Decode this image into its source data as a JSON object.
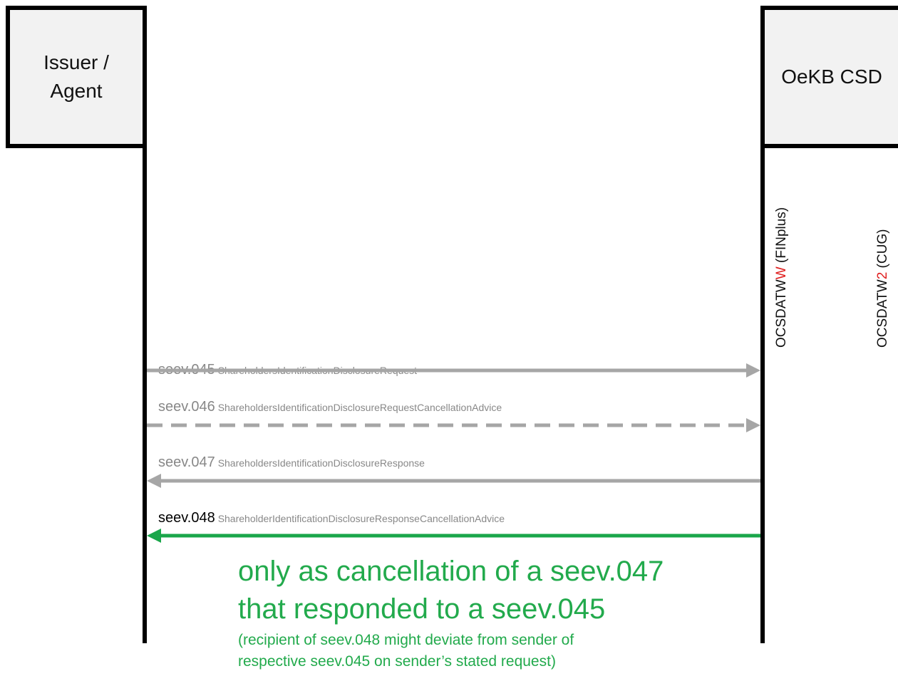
{
  "lanes": {
    "issuer": {
      "label_line1": "Issuer /",
      "label_line2": "Agent"
    },
    "csd": {
      "label": "OeKB CSD"
    }
  },
  "addresses": {
    "finplus": {
      "prefix": "OCSDATW",
      "highlight": "W",
      "suffix": " (FINplus)"
    },
    "cug": {
      "prefix": "OCSDATW",
      "highlight": "2",
      "suffix": " (CUG)"
    }
  },
  "messages": [
    {
      "code": "seev.045",
      "name": "ShareholdersIdentificationDisclosureRequest",
      "direction": "to-csd",
      "style": "solid",
      "color": "#a6a6a6"
    },
    {
      "code": "seev.046",
      "name": "ShareholdersIdentificationDisclosureRequestCancellationAdvice",
      "direction": "to-csd",
      "style": "dashed",
      "color": "#a6a6a6"
    },
    {
      "code": "seev.047",
      "name": "ShareholdersIdentificationDisclosureResponse",
      "direction": "to-issuer",
      "style": "solid",
      "color": "#a6a6a6"
    },
    {
      "code": "seev.048",
      "name": "ShareholderIdentificationDisclosureResponseCancellationAdvice",
      "direction": "to-issuer",
      "style": "solid",
      "color": "#1aa64a"
    }
  ],
  "note": {
    "line1": "only as cancellation of a seev.047",
    "line2": "that responded to a seev.045",
    "sub1": "(recipient of seev.048 might deviate from sender of",
    "sub2": "respective seev.045 on sender’s stated request)"
  },
  "colors": {
    "highlight_red": "#e02020",
    "note_green": "#22aa4c",
    "arrow_gray": "#a6a6a6",
    "arrow_green": "#1aa64a"
  }
}
